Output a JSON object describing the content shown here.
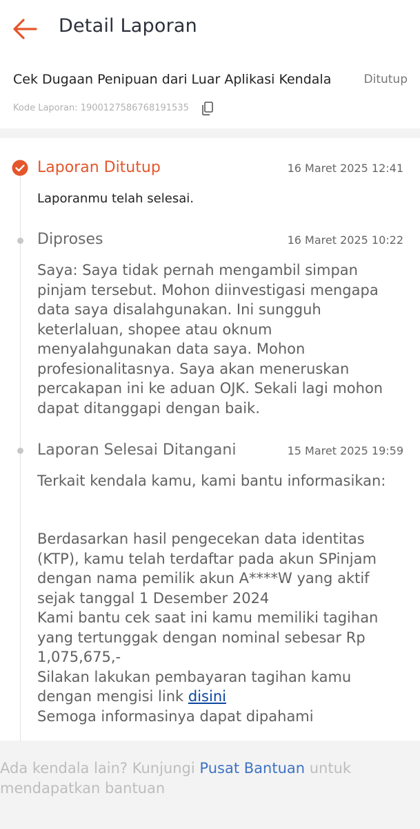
{
  "appbar": {
    "title": "Detail Laporan"
  },
  "report": {
    "title": "Cek Dugaan Penipuan dari Luar Aplikasi Kendala",
    "status": "Ditutup",
    "code_label": "Kode Laporan: 1900127586768191535"
  },
  "timeline": [
    {
      "title": "Laporan Ditutup",
      "time": "16 Maret 2025 12:41",
      "desc": "Laporanmu telah selesai."
    },
    {
      "title": "Diproses",
      "time": "16 Maret 2025 10:22",
      "desc": "Saya: Saya tidak pernah mengambil simpan pinjam tersebut. Mohon diinvestigasi mengapa data saya disalahgunakan. Ini sungguh keterlaluan, shopee atau oknum menyalahgunakan data saya. Mohon profesionalitasnya. Saya akan meneruskan percakapan ini ke aduan OJK. Sekali lagi mohon dapat ditanggapi dengan baik."
    },
    {
      "title": "Laporan Selesai Ditangani",
      "time": "15 Maret 2025 19:59",
      "intro": "Terkait kendala kamu, kami bantu informasikan:",
      "body": "Berdasarkan hasil pengecekan data identitas (KTP), kamu telah terdaftar pada akun SPinjam dengan nama pemilik akun A****W yang aktif sejak tanggal 1 Desember 2024",
      "tagihan": "Kami bantu cek saat ini kamu memiliki tagihan yang tertunggak dengan nominal sebesar Rp 1,075,675,-",
      "bayar_prefix": "Silakan lakukan pembayaran tagihan kamu dengan mengisi link",
      "bayar_link": "disini",
      "closing": "Semoga informasinya dapat dipahami"
    }
  ],
  "footer": {
    "prefix": "Ada kendala lain? Kunjungi",
    "link": "Pusat Bantuan",
    "suffix": "untuk mendapatkan bantuan"
  },
  "colors": {
    "accent": "#e4562b",
    "link": "#0d47a1",
    "footer_link": "#3d73c4"
  },
  "icons": {
    "back": "arrow-left-icon",
    "copy": "copy-icon",
    "check": "check-circle-icon",
    "dot": "timeline-dot-icon"
  }
}
